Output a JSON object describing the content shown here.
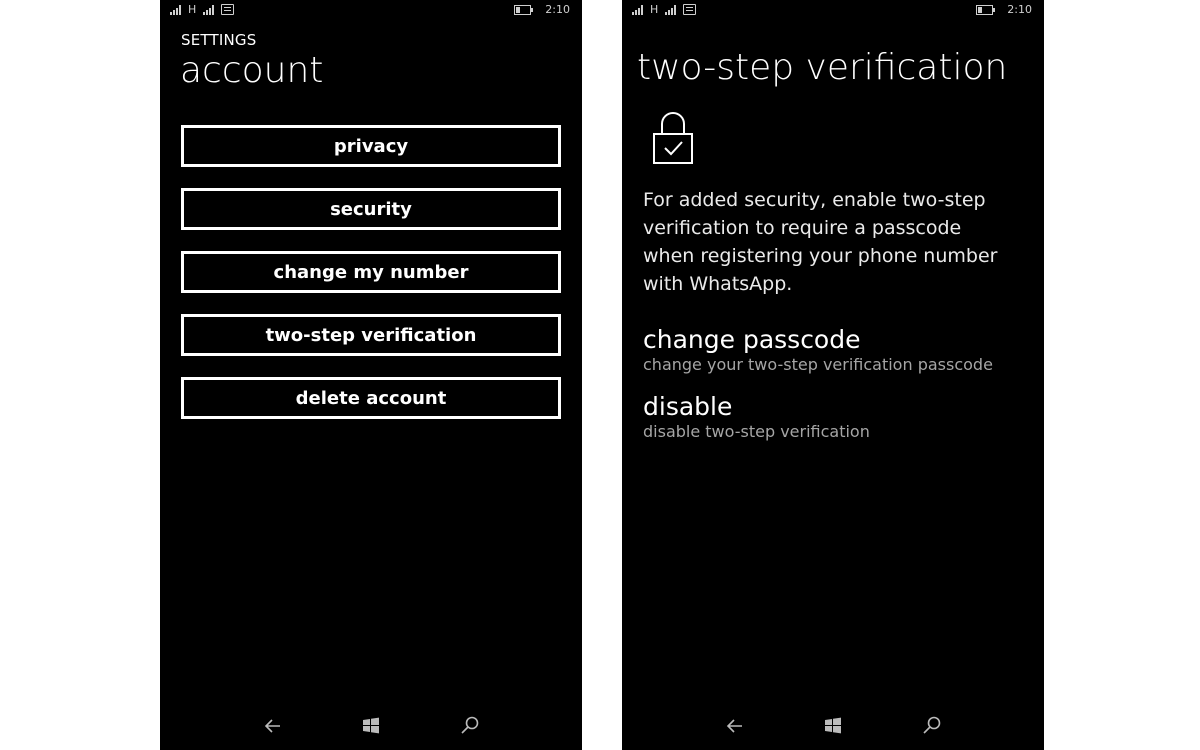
{
  "status_bar": {
    "network_1": "H",
    "time": "2:10"
  },
  "left_screen": {
    "header": "SETTINGS",
    "title": "account",
    "menu_items": [
      "privacy",
      "security",
      "change my number",
      "two-step verification",
      "delete account"
    ]
  },
  "right_screen": {
    "title": "two-step verification",
    "description": "For added security, enable two-step verification to require a passcode when registering your phone number with WhatsApp.",
    "options": [
      {
        "title": "change passcode",
        "subtitle": "change your two-step verification passcode"
      },
      {
        "title": "disable",
        "subtitle": "disable two-step verification"
      }
    ]
  },
  "icons": [
    "signal-icon",
    "message-icon",
    "battery-icon",
    "lock-check-icon",
    "back-arrow-icon",
    "windows-start-icon",
    "search-icon"
  ],
  "colors": {
    "background": "#000000",
    "text": "#ffffff",
    "secondary_text": "#a5a5a5",
    "page_bg": "#ffffff"
  }
}
